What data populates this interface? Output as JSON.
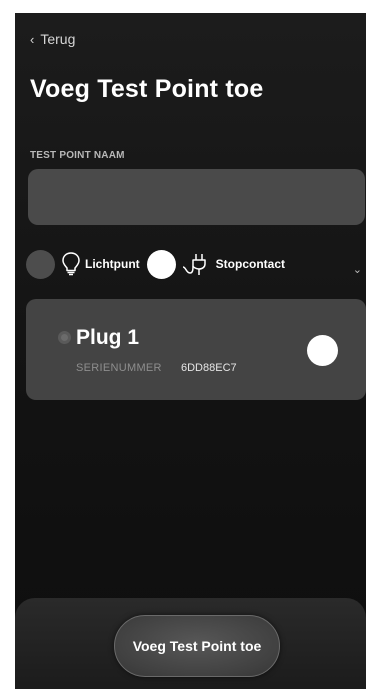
{
  "nav": {
    "back_chevron": "‹",
    "back_label": "Terug"
  },
  "page": {
    "title": "Voeg Test Point toe"
  },
  "form": {
    "name_label": "TEST POINT NAAM",
    "name_value": "",
    "name_placeholder": ""
  },
  "types": {
    "options": [
      {
        "label": "Lichtpunt",
        "icon": "lightbulb-icon",
        "selected": false
      },
      {
        "label": "Stopcontact",
        "icon": "plug-icon",
        "selected": true
      }
    ],
    "more_indicator": "⌄"
  },
  "device": {
    "name": "Plug 1",
    "serial_label": "SERIENUMMER",
    "serial_value": "6DD88EC7"
  },
  "actions": {
    "submit_label": "Voeg Test Point toe"
  }
}
